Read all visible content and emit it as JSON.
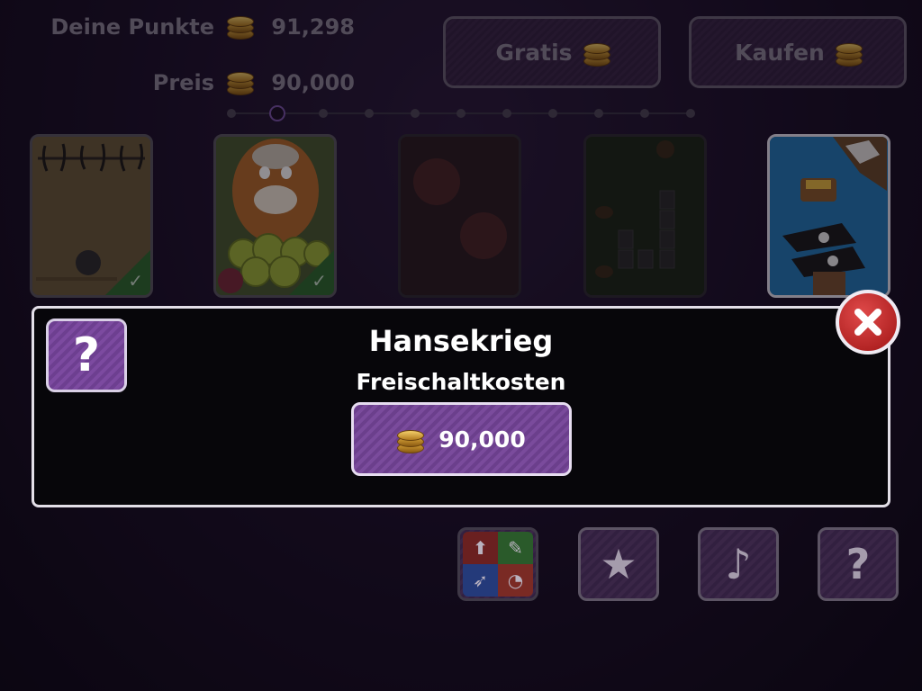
{
  "header": {
    "points_label": "Deine Punkte",
    "points_value": "91,298",
    "price_label": "Preis",
    "price_value": "90,000"
  },
  "buttons": {
    "gratis_label": "Gratis",
    "kaufen_label": "Kaufen"
  },
  "pager": {
    "count": 11,
    "active_index": 1
  },
  "levels": [
    {
      "name": "level-1",
      "unlocked": true
    },
    {
      "name": "level-2",
      "unlocked": true
    },
    {
      "name": "level-3",
      "unlocked": false
    },
    {
      "name": "level-4",
      "unlocked": false
    },
    {
      "name": "level-5-hansekrieg",
      "unlocked": false,
      "selected": true
    }
  ],
  "dialog": {
    "title": "Hansekrieg",
    "subtitle": "Freischaltkosten",
    "price": "90,000",
    "help_symbol": "?",
    "close_icon": "close-icon"
  },
  "bottom_bar": {
    "icons": [
      "game-modes-icon",
      "star-icon",
      "music-note-icon",
      "help-icon"
    ],
    "help_symbol": "?"
  },
  "colors": {
    "accent_purple": "#7a4b9c",
    "close_red": "#c0282a",
    "coin_gold": "#e0b04a"
  }
}
